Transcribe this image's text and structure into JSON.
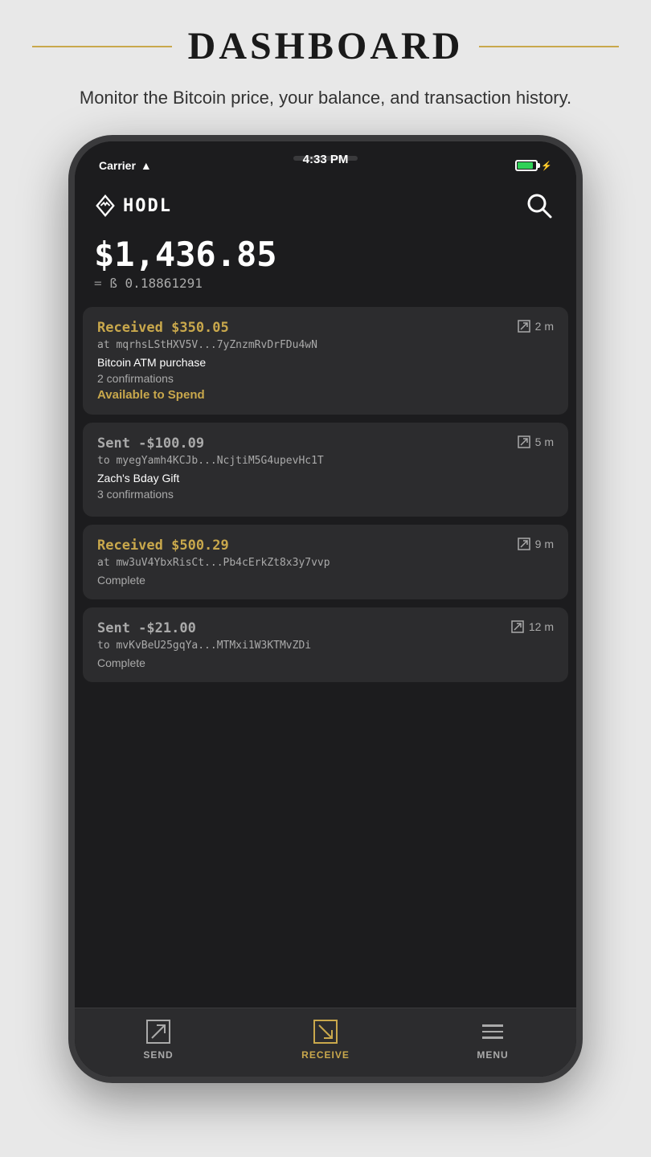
{
  "page": {
    "title": "DASHBOARD",
    "subtitle": "Monitor the Bitcoin price, your balance, and transaction history."
  },
  "status_bar": {
    "carrier": "Carrier",
    "time": "4:33 PM"
  },
  "app": {
    "name": "HODL",
    "balance_usd": "$1,436.85",
    "balance_separator": "=",
    "balance_btc": "ß 0.18861291"
  },
  "transactions": [
    {
      "type": "received",
      "amount": "Received $350.05",
      "address": "at mqrhsLStHXV5V...7yZnzmRvDrFDu4wN",
      "time": "2 m",
      "label": "Bitcoin ATM purchase",
      "confirmations": "2 confirmations",
      "status": "Available to Spend"
    },
    {
      "type": "sent",
      "amount": "Sent -$100.09",
      "address": "to myegYamh4KCJb...NcjtiM5G4upevHc1T",
      "time": "5 m",
      "label": "Zach's Bday Gift",
      "confirmations": "3 confirmations",
      "status": ""
    },
    {
      "type": "received",
      "amount": "Received $500.29",
      "address": "at mw3uV4YbxRisCt...Pb4cErkZt8x3y7vvp",
      "time": "9 m",
      "label": "",
      "confirmations": "",
      "status": "Complete"
    },
    {
      "type": "sent",
      "amount": "Sent -$21.00",
      "address": "to mvKvBeU25gqYa...MTMxi1W3KTMvZDi",
      "time": "12 m",
      "label": "",
      "confirmations": "",
      "status": "Complete"
    }
  ],
  "nav": {
    "send_label": "SEND",
    "receive_label": "RECEIVE",
    "menu_label": "MENU"
  },
  "colors": {
    "gold": "#c9a84c",
    "dark_bg": "#1c1c1e",
    "card_bg": "#2c2c2e"
  }
}
